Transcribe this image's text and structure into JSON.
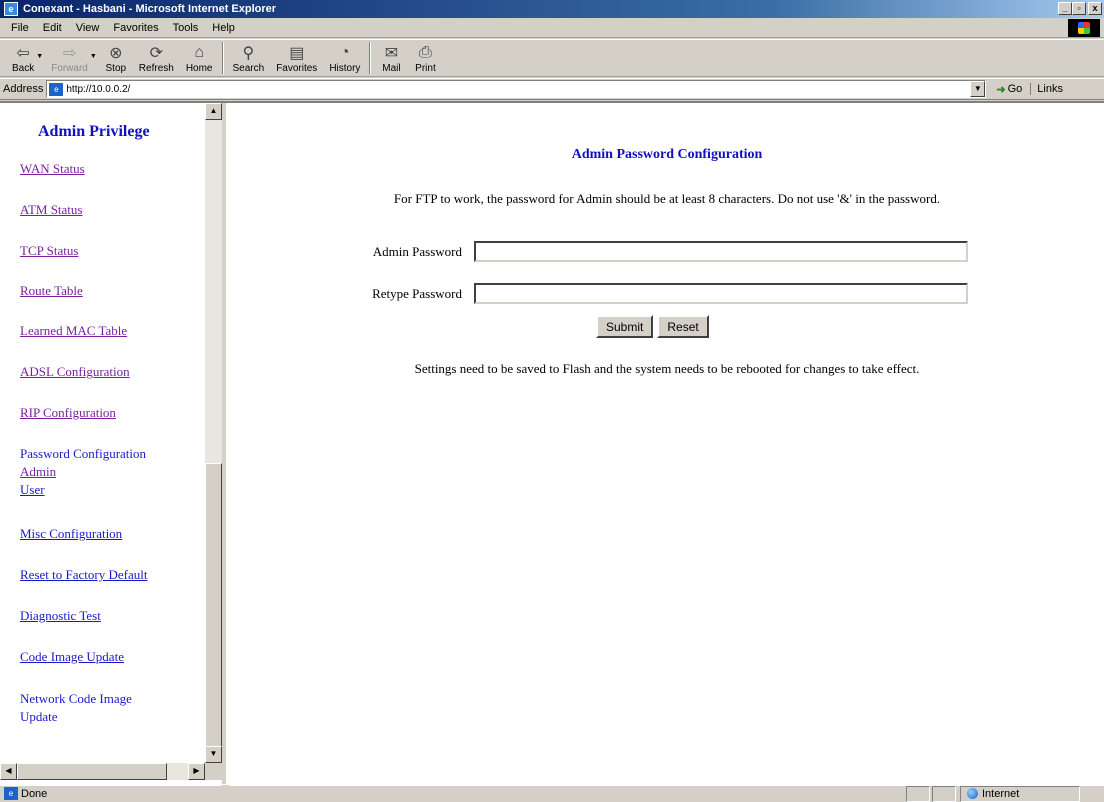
{
  "window": {
    "title": "Conexant - Hasbani - Microsoft Internet Explorer",
    "buttons": {
      "minimize": "_",
      "maximize": "▫",
      "close": "x"
    }
  },
  "menubar": [
    "File",
    "Edit",
    "View",
    "Favorites",
    "Tools",
    "Help"
  ],
  "toolbar": {
    "back": "Back",
    "forward": "Forward",
    "stop": "Stop",
    "refresh": "Refresh",
    "home": "Home",
    "search": "Search",
    "favorites": "Favorites",
    "history": "History",
    "mail": "Mail",
    "print": "Print"
  },
  "address": {
    "label": "Address",
    "url": "http://10.0.0.2/",
    "go": "Go",
    "links": "Links"
  },
  "sidebar": {
    "title": "Admin Privilege",
    "items": [
      {
        "label": "WAN Status"
      },
      {
        "label": "ATM Status"
      },
      {
        "label": "TCP Status"
      },
      {
        "label": "Route Table"
      },
      {
        "label": "Learned MAC Table"
      },
      {
        "label": "ADSL Configuration"
      },
      {
        "label": "RIP Configuration"
      },
      {
        "label": "Password Configuration"
      },
      {
        "label": "Admin"
      },
      {
        "label": "User"
      },
      {
        "label": "Misc Configuration"
      },
      {
        "label": "Reset to Factory Default"
      },
      {
        "label": "Diagnostic Test"
      },
      {
        "label": "Code Image Update"
      },
      {
        "label": "Network Code Image"
      },
      {
        "label": "Update"
      }
    ]
  },
  "main": {
    "title": "Admin Password Configuration",
    "intro": "For FTP to work, the password for Admin should be at least 8 characters. Do not use '&' in the password.",
    "fields": [
      {
        "label": "Admin Password",
        "value": ""
      },
      {
        "label": "Retype Password",
        "value": ""
      }
    ],
    "submit": "Submit",
    "reset": "Reset",
    "note": "Settings need to be saved to Flash and the system needs to be rebooted for changes to take effect."
  },
  "status": {
    "text": "Done",
    "zone": "Internet"
  }
}
